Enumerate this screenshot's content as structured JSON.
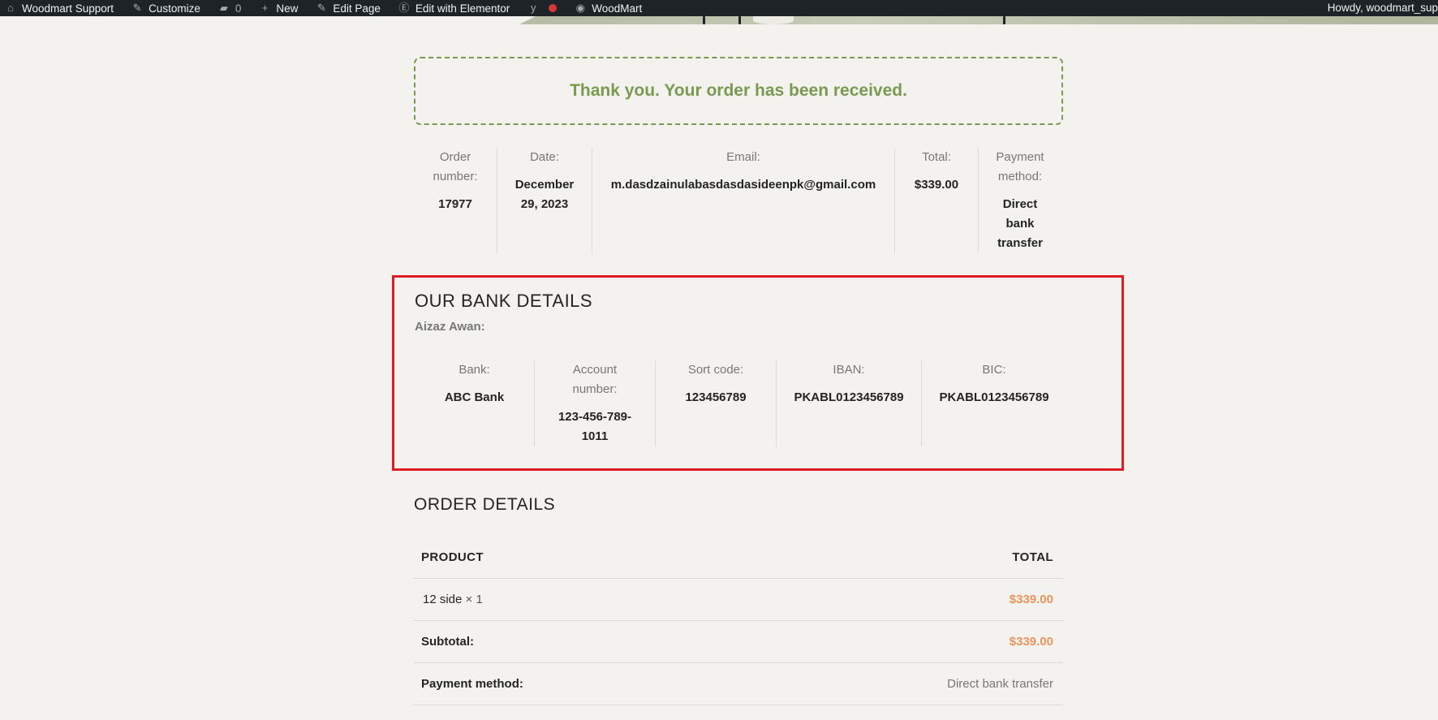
{
  "adminbar": {
    "site_name": "Woodmart Support",
    "customize": "Customize",
    "comments_count": "0",
    "new": "New",
    "edit_page": "Edit Page",
    "edit_elementor": "Edit with Elementor",
    "woodmart": "WoodMart",
    "howdy": "Howdy, woodmart_sup"
  },
  "notice": {
    "text": "Thank you. Your order has been received."
  },
  "overview": {
    "order_number_label": "Order number:",
    "order_number": "17977",
    "date_label": "Date:",
    "date": "December 29, 2023",
    "email_label": "Email:",
    "email": "m.dasdzainulabasdasdasideenpk@gmail.com",
    "total_label": "Total:",
    "total": "$339.00",
    "payment_label": "Payment method:",
    "payment": "Direct bank transfer"
  },
  "bank": {
    "title": "OUR BANK DETAILS",
    "holder": "Aizaz Awan:",
    "bank_label": "Bank:",
    "bank": "ABC Bank",
    "account_label": "Account number:",
    "account": "123-456-789-1011",
    "sort_label": "Sort code:",
    "sort": "123456789",
    "iban_label": "IBAN:",
    "iban": "PKABL0123456789",
    "bic_label": "BIC:",
    "bic": "PKABL0123456789"
  },
  "order_details": {
    "title": "ORDER DETAILS",
    "col_product": "PRODUCT",
    "col_total": "TOTAL",
    "item_name": "12 side",
    "item_qty": "× 1",
    "item_total": "$339.00",
    "subtotal_label": "Subtotal:",
    "subtotal": "$339.00",
    "payment_label": "Payment method:",
    "payment": "Direct bank transfer"
  },
  "colors": {
    "accent_green": "#7a9a51",
    "price_orange": "#e9955c",
    "highlight_red": "#e01b24"
  }
}
